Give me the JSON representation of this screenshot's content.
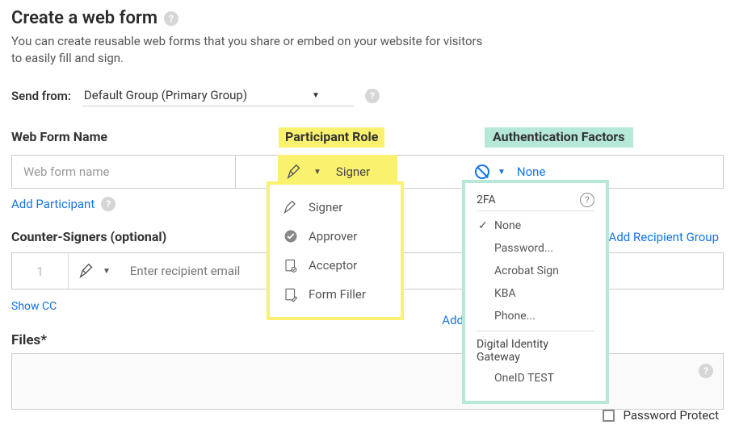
{
  "header": {
    "title": "Create a web form",
    "subtitle": "You can create reusable web forms that you share or embed on your website for visitors to easily fill and sign."
  },
  "send_from": {
    "label": "Send from:",
    "value": "Default Group (Primary Group)"
  },
  "section_labels": {
    "web_form_name": "Web Form Name",
    "participant_role": "Participant Role",
    "auth_factors": "Authentication Factors"
  },
  "web_form_name": {
    "placeholder": "Web form name"
  },
  "role_selected": "Signer",
  "auth_selected": "None",
  "add_participant": "Add Participant",
  "counter": {
    "label": "Counter-Signers (optional)",
    "index": "1",
    "placeholder": "Enter recipient email"
  },
  "add_recipient_group": "Add Recipient Group",
  "show_cc": "Show CC",
  "files": {
    "label": "Files*",
    "add_link": "Add F"
  },
  "password_protect": "Password Protect",
  "role_options": [
    {
      "key": "signer",
      "label": "Signer"
    },
    {
      "key": "approver",
      "label": "Approver"
    },
    {
      "key": "acceptor",
      "label": "Acceptor"
    },
    {
      "key": "form-filler",
      "label": "Form Filler"
    }
  ],
  "auth_dropdown": {
    "section_2fa": "2FA",
    "items": [
      {
        "label": "None",
        "checked": true
      },
      {
        "label": "Password...",
        "checked": false
      },
      {
        "label": "Acrobat Sign",
        "checked": false
      },
      {
        "label": "KBA",
        "checked": false
      },
      {
        "label": "Phone...",
        "checked": false
      }
    ],
    "section_dig": "Digital Identity Gateway",
    "items2": [
      {
        "label": "OneID TEST",
        "checked": false
      }
    ]
  }
}
